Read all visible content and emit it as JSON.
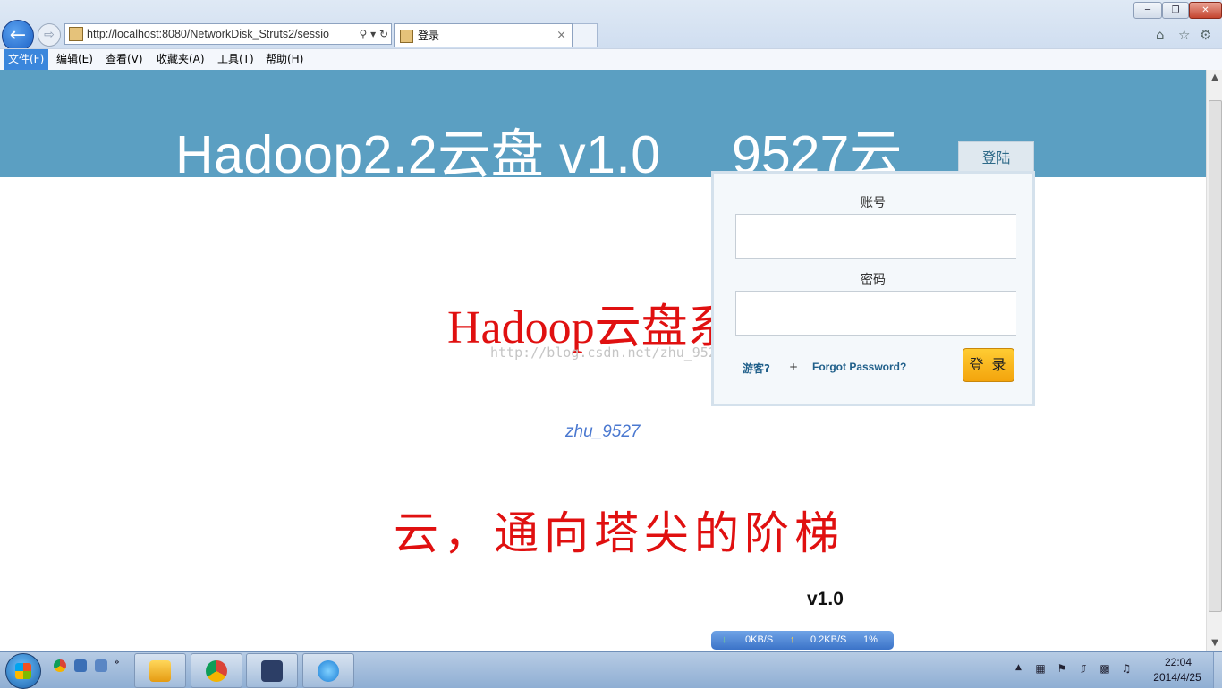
{
  "browser": {
    "url": "http://localhost:8080/NetworkDisk_Struts2/sessio",
    "tab_title": "登录",
    "tab_close": "×",
    "menu": [
      "文件(F)",
      "编辑(E)",
      "查看(V)",
      "收藏夹(A)",
      "工具(T)",
      "帮助(H)"
    ],
    "active_menu": "文件(F)"
  },
  "page": {
    "banner_title": "Hadoop2.2云盘 v1.0",
    "banner_brand": "9527云",
    "login_tab": "登陆",
    "login": {
      "account_label": "账号",
      "password_label": "密码",
      "guest_link": "游客?",
      "separator": "+",
      "forgot_link": "Forgot Password?",
      "submit_label": "登 录"
    },
    "hero_title": "Hadoop云盘系",
    "watermark": "http://blog.csdn.net/zhu_9527",
    "author": "zhu_9527",
    "slogan": "云，通向塔尖的阶梯",
    "version": "v1.0"
  },
  "netmon": {
    "download": "0KB/S",
    "upload": "0.2KB/S",
    "percent": "1%"
  },
  "taskbar": {
    "time": "22:04",
    "date": "2014/4/25"
  },
  "colors": {
    "banner": "#5b9fc2",
    "hero_red": "#e01010",
    "login_button": "#f7b519",
    "link": "#1f5f8a"
  }
}
